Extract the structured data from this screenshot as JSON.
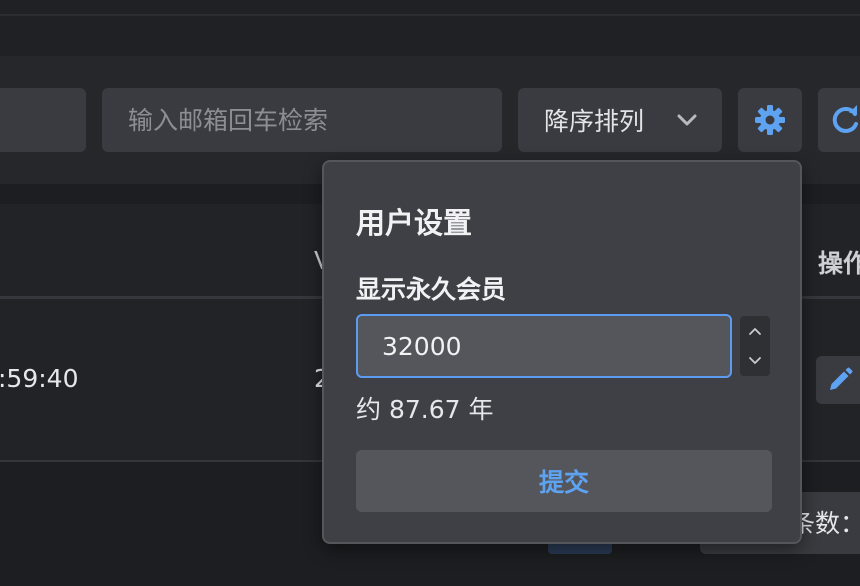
{
  "toolbar": {
    "search_placeholder": "输入邮箱回车检索",
    "sort_label": "降序排列"
  },
  "table": {
    "columns": {
      "v_partial": "V",
      "actions": "操作"
    },
    "row": {
      "time_partial": ":59:40",
      "value_partial": "2"
    }
  },
  "footer": {
    "count_partial": "条数："
  },
  "popover": {
    "title": "用户设置",
    "field_label": "显示永久会员",
    "field_value": "32000",
    "hint": "约 87.67 年",
    "submit_label": "提交"
  },
  "colors": {
    "accent": "#5ea2f2",
    "background": "#1d1e21",
    "panel": "#3f4045"
  },
  "icons": {
    "sort": "chevron-down-icon",
    "settings": "gear-icon",
    "refresh": "refresh-icon",
    "edit": "pencil-icon",
    "stepper_up": "chevron-up-icon",
    "stepper_down": "chevron-down-icon"
  }
}
